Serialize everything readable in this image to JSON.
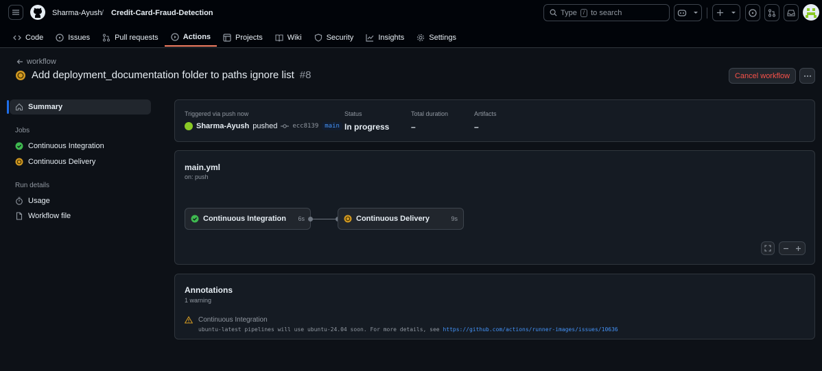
{
  "header": {
    "owner": "Sharma-Ayush",
    "separator": "/",
    "repo": "Credit-Card-Fraud-Detection",
    "search_prefix": "Type",
    "search_key": "/",
    "search_suffix": "to search"
  },
  "tabs": [
    {
      "label": "Code",
      "icon": "code-icon"
    },
    {
      "label": "Issues",
      "icon": "issue-icon"
    },
    {
      "label": "Pull requests",
      "icon": "pull-request-icon"
    },
    {
      "label": "Actions",
      "icon": "play-icon",
      "selected": true
    },
    {
      "label": "Projects",
      "icon": "table-icon"
    },
    {
      "label": "Wiki",
      "icon": "book-icon"
    },
    {
      "label": "Security",
      "icon": "shield-icon"
    },
    {
      "label": "Insights",
      "icon": "graph-icon"
    },
    {
      "label": "Settings",
      "icon": "gear-icon"
    }
  ],
  "run": {
    "back_label": "workflow",
    "title": "Add deployment_documentation folder to paths ignore list",
    "number": "#8",
    "cancel_label": "Cancel workflow"
  },
  "sidebar": {
    "summary": "Summary",
    "jobs_heading": "Jobs",
    "jobs": [
      {
        "label": "Continuous Integration",
        "status": "success"
      },
      {
        "label": "Continuous Delivery",
        "status": "in_progress"
      }
    ],
    "run_details_heading": "Run details",
    "details": [
      {
        "label": "Usage",
        "icon": "stopwatch-icon"
      },
      {
        "label": "Workflow file",
        "icon": "file-icon"
      }
    ]
  },
  "summary": {
    "triggered_label": "Triggered via push now",
    "user": "Sharma-Ayush",
    "action": "pushed",
    "commit": "ecc8139",
    "branch": "main",
    "status_label": "Status",
    "status_value": "In progress",
    "duration_label": "Total duration",
    "duration_value": "–",
    "artifacts_label": "Artifacts",
    "artifacts_value": "–"
  },
  "graph": {
    "file": "main.yml",
    "trigger": "on: push",
    "jobs": [
      {
        "label": "Continuous Integration",
        "duration": "6s",
        "status": "success"
      },
      {
        "label": "Continuous Delivery",
        "duration": "9s",
        "status": "in_progress"
      }
    ]
  },
  "annotations": {
    "title": "Annotations",
    "count": "1 warning",
    "job": "Continuous Integration",
    "message": "ubuntu-latest pipelines will use ubuntu-24.04 soon. For more details, see",
    "url": "https://github.com/actions/runner-images/issues/10636"
  },
  "colors": {
    "success": "#3fb950",
    "in_progress": "#d29922",
    "danger": "#f85149",
    "link": "#4493f8",
    "tab_underline": "#f78166"
  }
}
